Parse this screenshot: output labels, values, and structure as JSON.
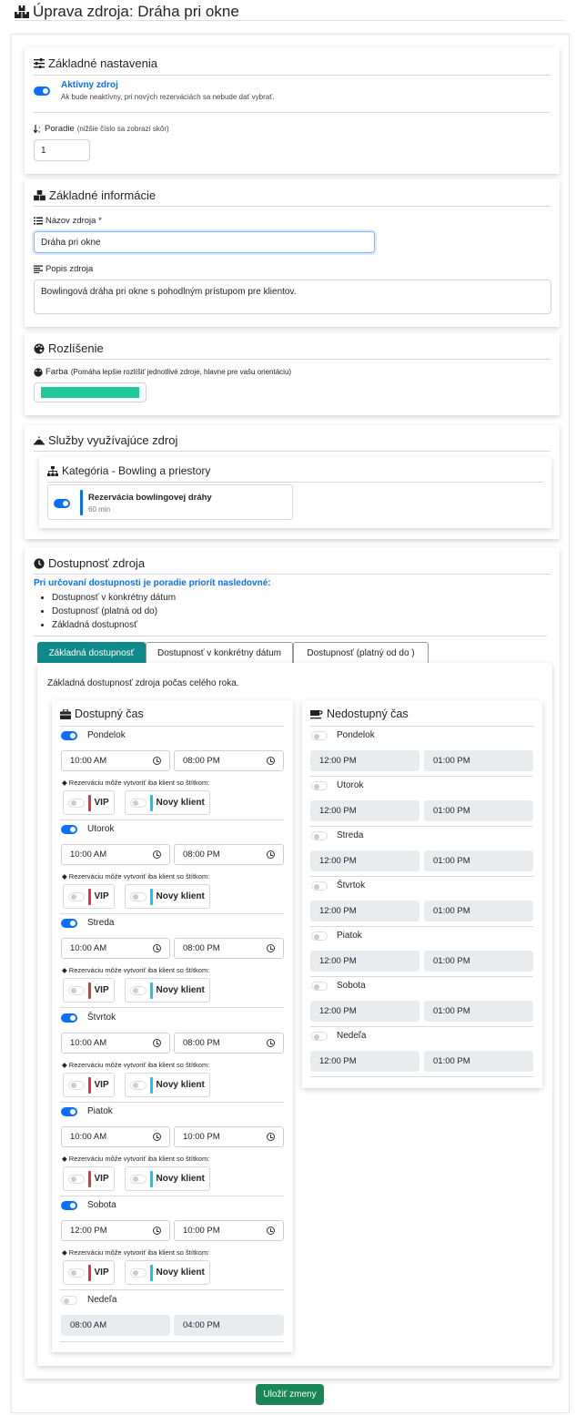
{
  "page": {
    "title": "Úprava zdroja: Dráha pri okne",
    "save_label": "Uložiť zmeny"
  },
  "basic_settings": {
    "title": "Základné nastavenia",
    "active_label": "Aktívny zdroj",
    "active_on": true,
    "active_help": "Ak bude neaktívny, pri nových rezerváciách sa nebude dať vybrať.",
    "order_label": "Poradie",
    "order_hint": "(nižšie číslo sa zobrazí skôr)",
    "order_value": "1"
  },
  "basic_info": {
    "title": "Základné informácie",
    "name_label": "Názov zdroja *",
    "name_value": "Dráha pri okne",
    "desc_label": "Popis zdroja",
    "desc_value": "Bowlingová dráha pri okne s pohodlným prístupom pre klientov."
  },
  "distinction": {
    "title": "Rozlíšenie",
    "color_label": "Farba",
    "color_hint": "(Pomáha lepšie rozlíšiť jednotlivé zdroje, hlavne pre vašu orientáciu)",
    "color": "#20c997"
  },
  "services": {
    "title": "Služby využívajúce zdroj",
    "category": "Kategória - Bowling a priestory",
    "service_name": "Rezervácia bowlingovej dráhy",
    "service_duration": "60 min",
    "service_color": "#0d6efd"
  },
  "availability": {
    "title": "Dostupnosť zdroja",
    "priority_heading": "Pri určovaní dostupnosti je poradie priorít nasledovné:",
    "priority_items": [
      "Dostupnosť v konkrétny dátum",
      "Dostupnosť (platná od do)",
      "Základná dostupnosť"
    ],
    "tabs": [
      "Základná dostupnosť",
      "Dostupnosť v konkrétny dátum",
      "Dostupnosť (platný od  do  )"
    ],
    "tab_desc": "Základná dostupnosť zdroja počas celého roka.",
    "available_title": "Dostupný čas",
    "unavailable_title": "Nedostupný čas",
    "tag_caption": "Rezerváciu môže vytvoriť iba klient so štítkom:",
    "tag_vip": "VIP",
    "tag_new": "Novy klient",
    "tag_vip_color": "#dc3545",
    "tag_new_color": "#0dcaf0",
    "available": [
      {
        "day": "Pondelok",
        "on": true,
        "from": "10:00 AM",
        "to": "08:00 PM"
      },
      {
        "day": "Utorok",
        "on": true,
        "from": "10:00 AM",
        "to": "08:00 PM"
      },
      {
        "day": "Streda",
        "on": true,
        "from": "10:00 AM",
        "to": "08:00 PM"
      },
      {
        "day": "Štvrtok",
        "on": true,
        "from": "10:00 AM",
        "to": "08:00 PM"
      },
      {
        "day": "Piatok",
        "on": true,
        "from": "10:00 AM",
        "to": "10:00 PM"
      },
      {
        "day": "Sobota",
        "on": true,
        "from": "12:00 PM",
        "to": "10:00 PM"
      },
      {
        "day": "Nedeľa",
        "on": false,
        "from": "08:00 AM",
        "to": "04:00 PM"
      }
    ],
    "unavailable": [
      {
        "day": "Pondelok",
        "on": false,
        "from": "12:00 PM",
        "to": "01:00 PM"
      },
      {
        "day": "Utorok",
        "on": false,
        "from": "12:00 PM",
        "to": "01:00 PM"
      },
      {
        "day": "Streda",
        "on": false,
        "from": "12:00 PM",
        "to": "01:00 PM"
      },
      {
        "day": "Štvrtok",
        "on": false,
        "from": "12:00 PM",
        "to": "01:00 PM"
      },
      {
        "day": "Piatok",
        "on": false,
        "from": "12:00 PM",
        "to": "01:00 PM"
      },
      {
        "day": "Sobota",
        "on": false,
        "from": "12:00 PM",
        "to": "01:00 PM"
      },
      {
        "day": "Nedeľa",
        "on": false,
        "from": "12:00 PM",
        "to": "01:00 PM"
      }
    ]
  }
}
